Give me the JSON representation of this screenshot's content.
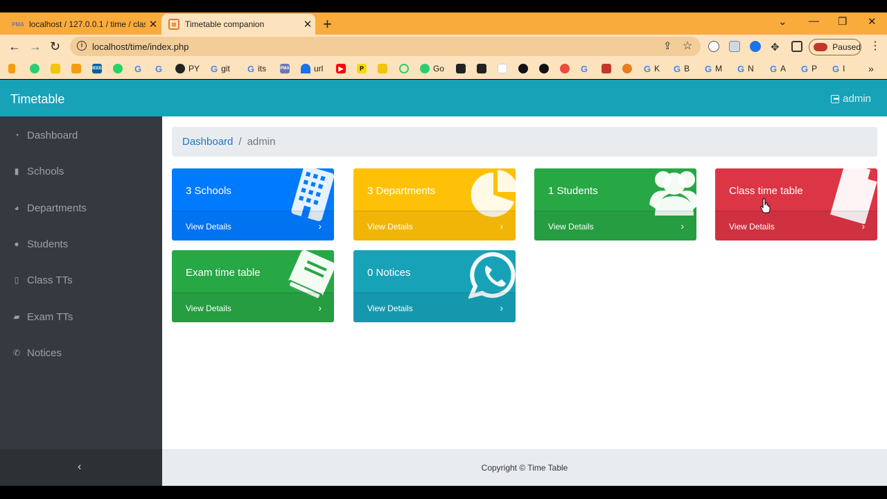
{
  "browser": {
    "tabs": [
      {
        "title": "localhost / 127.0.0.1 / time / clas",
        "favicon": "phpmyadmin-icon"
      },
      {
        "title": "Timetable companion",
        "favicon": "app-icon",
        "active": true
      }
    ],
    "url": "localhost/time/index.php",
    "profile_status": "Paused",
    "bookmarks": [
      "PY",
      "git",
      "its",
      "url",
      "Go",
      "K",
      "B",
      "M",
      "N",
      "A",
      "P",
      "I"
    ]
  },
  "app": {
    "brand": "Timetable",
    "user": "admin",
    "sidebar": {
      "items": [
        {
          "label": "Dashboard",
          "icon": "dashboard-icon"
        },
        {
          "label": "Schools",
          "icon": "book-icon"
        },
        {
          "label": "Departments",
          "icon": "pie-chart-icon"
        },
        {
          "label": "Students",
          "icon": "users-icon"
        },
        {
          "label": "Class TTs",
          "icon": "file-icon"
        },
        {
          "label": "Exam TTs",
          "icon": "book-open-icon"
        },
        {
          "label": "Notices",
          "icon": "whatsapp-icon"
        }
      ],
      "collapse_icon": "chevron-left-icon"
    },
    "breadcrumb": {
      "link": "Dashboard",
      "current": "admin"
    },
    "cards": [
      {
        "title": "3 Schools",
        "footer": "View Details",
        "color": "#007bff",
        "icon": "building-icon"
      },
      {
        "title": "3 Departments",
        "footer": "View Details",
        "color": "#ffc107",
        "icon": "pie-chart-icon"
      },
      {
        "title": "1 Students",
        "footer": "View Details",
        "color": "#28a745",
        "icon": "users-icon"
      },
      {
        "title": "Class time table",
        "footer": "View Details",
        "color": "#dc3545",
        "icon": "file-icon"
      },
      {
        "title": "Exam time table",
        "footer": "View Details",
        "color": "#28a745",
        "icon": "book-icon"
      },
      {
        "title": "0 Notices",
        "footer": "View Details",
        "color": "#17a2b8",
        "icon": "whatsapp-icon"
      }
    ],
    "footer": "Copyright © Time Table"
  }
}
